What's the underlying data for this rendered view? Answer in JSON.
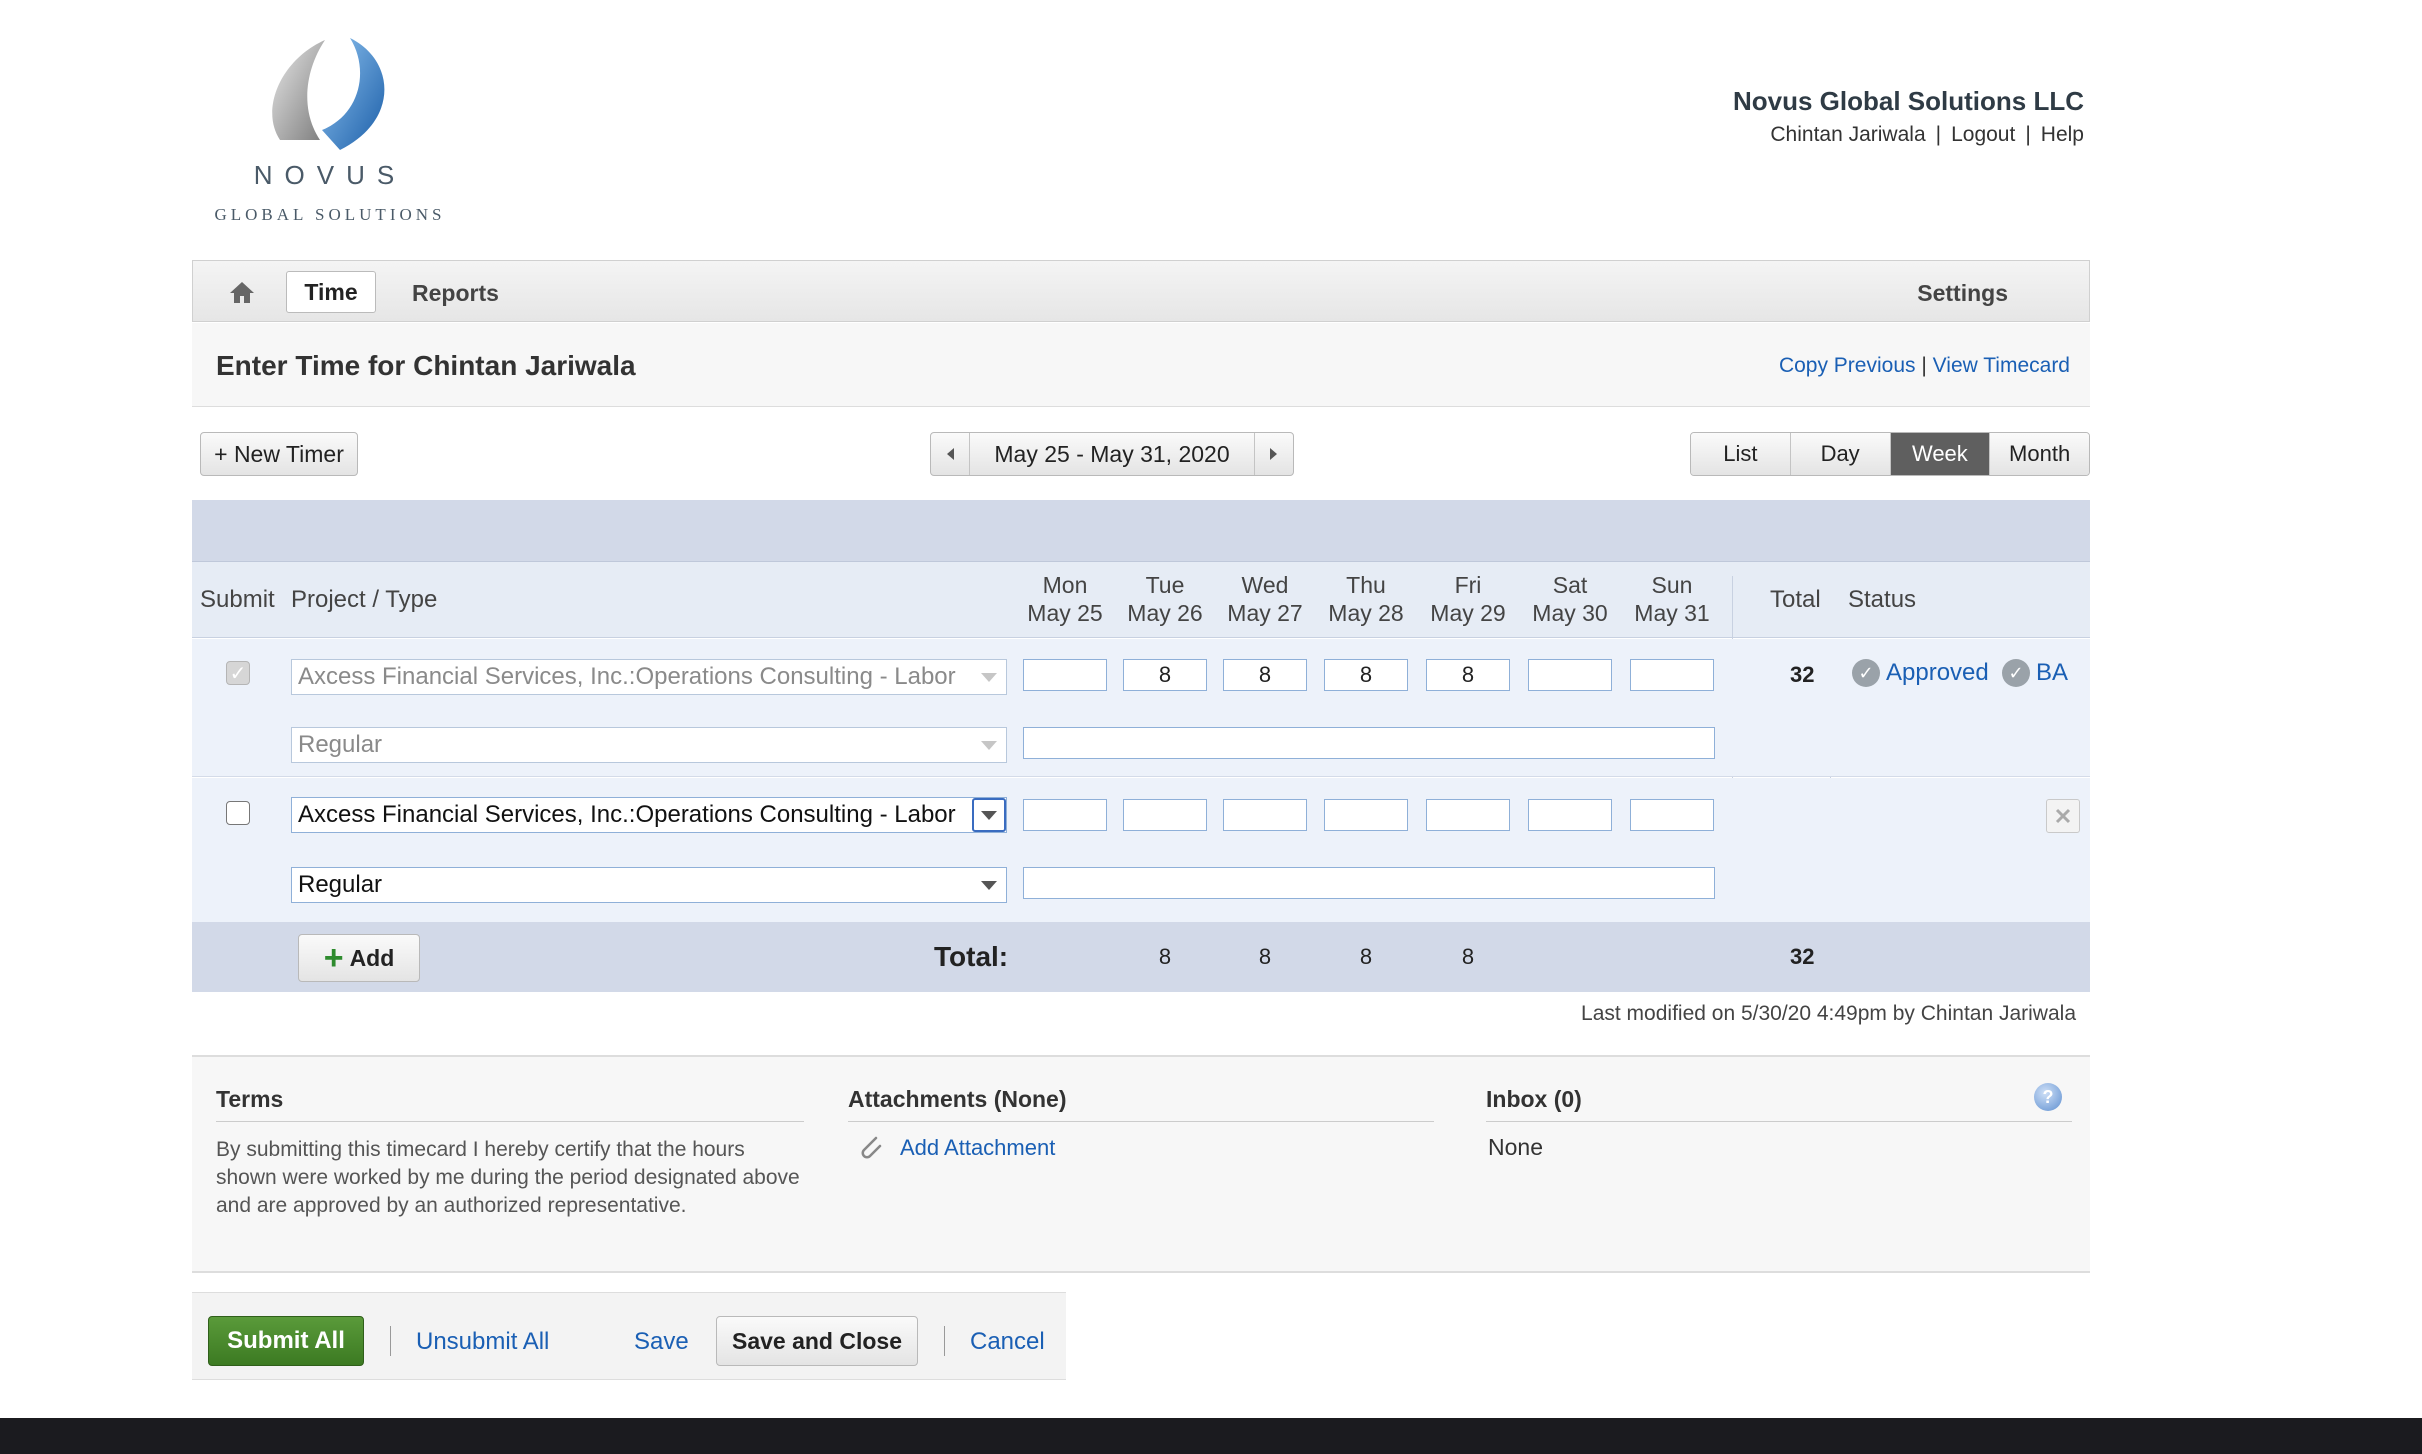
{
  "header": {
    "logo_word": "NOVUS",
    "logo_tagline": "GLOBAL SOLUTIONS",
    "company": "Novus Global Solutions LLC",
    "user_name": "Chintan Jariwala",
    "logout": "Logout",
    "help": "Help"
  },
  "nav": {
    "home_icon": "home-icon",
    "time": "Time",
    "reports": "Reports",
    "settings": "Settings"
  },
  "page": {
    "title_prefix": "Enter Time for",
    "title_name": "Chintan Jariwala",
    "copy_previous": "Copy Previous",
    "link_sep": "|",
    "view_timecard": "View Timecard"
  },
  "toolbar": {
    "new_timer": "+ New Timer",
    "date_range": "May 25 - May 31, 2020",
    "views": [
      "List",
      "Day",
      "Week",
      "Month"
    ],
    "active_view": "Week"
  },
  "grid": {
    "headers": {
      "submit": "Submit",
      "project": "Project / Type",
      "total": "Total",
      "status": "Status"
    },
    "days": [
      {
        "dow": "Mon",
        "date": "May 25"
      },
      {
        "dow": "Tue",
        "date": "May 26"
      },
      {
        "dow": "Wed",
        "date": "May 27"
      },
      {
        "dow": "Thu",
        "date": "May 28"
      },
      {
        "dow": "Fri",
        "date": "May 29"
      },
      {
        "dow": "Sat",
        "date": "May 30"
      },
      {
        "dow": "Sun",
        "date": "May 31"
      }
    ],
    "rows": [
      {
        "submitted": true,
        "project": "Axcess Financial Services, Inc.:Operations Consulting - Labor",
        "type": "Regular",
        "hours": [
          "",
          "8",
          "8",
          "8",
          "8",
          "",
          ""
        ],
        "total": "32",
        "status": "Approved",
        "approver": "BA"
      },
      {
        "submitted": false,
        "project": "Axcess Financial Services, Inc.:Operations Consulting - Labor",
        "type": "Regular",
        "hours": [
          "",
          "",
          "",
          "",
          "",
          "",
          ""
        ],
        "total": "",
        "status": "",
        "approver": ""
      }
    ],
    "add_label": "Add",
    "total_label": "Total:",
    "day_totals": [
      "",
      "8",
      "8",
      "8",
      "8",
      "",
      ""
    ],
    "grand_total": "32"
  },
  "last_modified": "Last modified on 5/30/20 4:49pm by Chintan Jariwala",
  "panels": {
    "terms_title": "Terms",
    "terms_text": "By submitting this timecard I hereby certify that the hours shown were worked by me during the period designated above and are approved by an authorized representative.",
    "attachments_title": "Attachments (None)",
    "add_attachment": "Add Attachment",
    "inbox_title": "Inbox (0)",
    "inbox_value": "None"
  },
  "actions": {
    "submit_all": "Submit All",
    "unsubmit_all": "Unsubmit All",
    "save": "Save",
    "save_and_close": "Save and Close",
    "cancel": "Cancel"
  },
  "colors": {
    "link": "#1a5fb4",
    "band": "#d2d9e8",
    "row_bg": "#edf2fa",
    "submit_green": "#3c7a22",
    "active_view": "#5f5f5f"
  }
}
